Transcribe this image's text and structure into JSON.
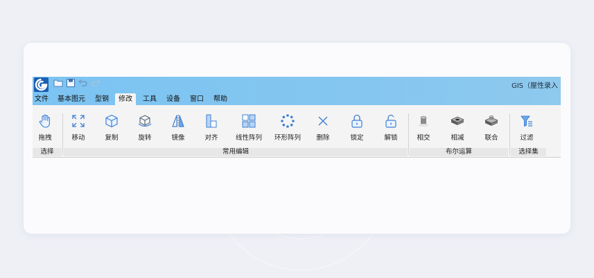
{
  "window": {
    "title": "GIS（屋性录入"
  },
  "quick_access": [
    "folder-icon",
    "save-icon",
    "undo-icon",
    "redo-icon"
  ],
  "menu": {
    "items": [
      {
        "label": "文件"
      },
      {
        "label": "基本图元"
      },
      {
        "label": "型钢"
      },
      {
        "label": "修改",
        "active": true
      },
      {
        "label": "工具"
      },
      {
        "label": "设备"
      },
      {
        "label": "窗口"
      },
      {
        "label": "帮助"
      }
    ]
  },
  "ribbon": {
    "groups": [
      {
        "name": "选择",
        "tools": [
          {
            "label": "拖拽",
            "icon": "drag-hand-icon"
          }
        ]
      },
      {
        "name": "常用编辑",
        "tools": [
          {
            "label": "移动",
            "icon": "move-icon"
          },
          {
            "label": "复制",
            "icon": "copy-icon"
          },
          {
            "label": "旋转",
            "icon": "rotate-icon"
          },
          {
            "label": "镜像",
            "icon": "mirror-icon"
          },
          {
            "label": "对齐",
            "icon": "align-icon"
          },
          {
            "label": "线性阵列",
            "icon": "linear-array-icon"
          },
          {
            "label": "环形阵列",
            "icon": "circular-array-icon"
          },
          {
            "label": "删除",
            "icon": "delete-icon"
          },
          {
            "label": "锁定",
            "icon": "lock-icon"
          },
          {
            "label": "解锁",
            "icon": "unlock-icon"
          }
        ]
      },
      {
        "name": "布尔运算",
        "tools": [
          {
            "label": "相交",
            "icon": "intersect-icon"
          },
          {
            "label": "相减",
            "icon": "subtract-icon"
          },
          {
            "label": "联合",
            "icon": "union-icon"
          }
        ]
      },
      {
        "name": "选择集",
        "tools": [
          {
            "label": "过滤",
            "icon": "filter-icon"
          }
        ]
      }
    ]
  },
  "colors": {
    "accent": "#4a90e2",
    "titlebar": "#7cc4f2",
    "ribbon_bg": "#f4f4f4"
  }
}
